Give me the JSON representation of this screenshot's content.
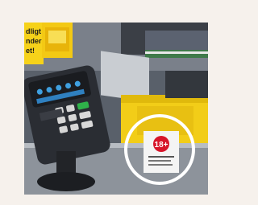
{
  "photo": {
    "left_sign_text": [
      "dligt",
      "nder",
      "et!"
    ],
    "age_badge": "18+",
    "colors": {
      "background": "#f6f1ec",
      "sign_yellow": "#f6d21a",
      "terminal_dark": "#2a2d33",
      "screen_blue": "#3fa0e0",
      "green_key": "#2fb24a",
      "badge_red": "#d7152a",
      "circle": "#ffffff"
    },
    "highlight": "age-restriction-label"
  }
}
